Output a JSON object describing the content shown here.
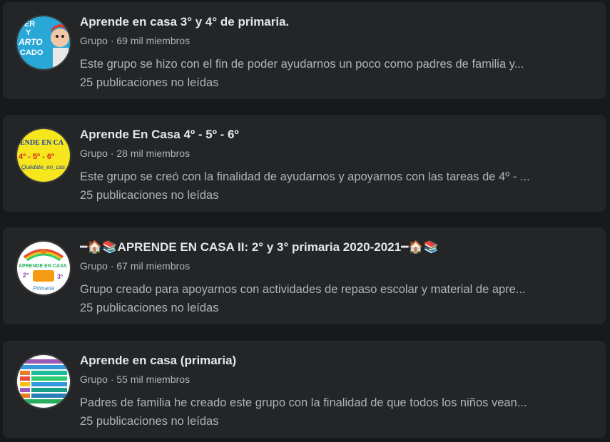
{
  "groups": [
    {
      "title": "Aprende en casa 3° y 4° de primaria.",
      "type": "Grupo",
      "separator": "·",
      "members": "69 mil miembros",
      "description": "Este grupo se hizo con el fin de poder ayudarnos un poco como padres de familia y...",
      "unread": "25 publicaciones no leídas",
      "avatar_icon": "cartoon-avatar-icon",
      "avatar_text": [
        "CER",
        "Y",
        "ARTO",
        "CADO"
      ],
      "avatar_bg": "#29a8d8"
    },
    {
      "title": "Aprende En Casa 4º - 5º - 6º",
      "type": "Grupo",
      "separator": "·",
      "members": "28 mil miembros",
      "description": "Este grupo se creó con la finalidad de ayudarnos y apoyarnos con las tareas de 4º - ...",
      "unread": "25 publicaciones no leídas",
      "avatar_icon": "yellow-logo-avatar-icon",
      "avatar_text": [
        "ENDE EN CA",
        "4º - 5º - 6º",
        "Quédate_en_cas"
      ],
      "avatar_bg": "#f5e61e"
    },
    {
      "title": "━🏠📚APRENDE EN CASA II: 2° y 3° primaria 2020-2021━🏠📚",
      "type": "Grupo",
      "separator": "·",
      "members": "67 mil miembros",
      "description": "Grupo creado para apoyarnos con actividades de repaso escolar y material de apre...",
      "unread": "25 publicaciones no leídas",
      "avatar_icon": "colorful-school-avatar-icon",
      "avatar_text": [
        "APRENDE EN CASA",
        "2°",
        "3°",
        "Primaria"
      ],
      "avatar_bg": "#ffffff"
    },
    {
      "title": "Aprende en casa (primaria)",
      "type": "Grupo",
      "separator": "·",
      "members": "55 mil miembros",
      "description": "Padres de familia he creado este grupo con la finalidad de que todos los niños vean...",
      "unread": "25 publicaciones no leídas",
      "avatar_icon": "schedule-table-avatar-icon",
      "avatar_bg": "#ffffff"
    }
  ]
}
